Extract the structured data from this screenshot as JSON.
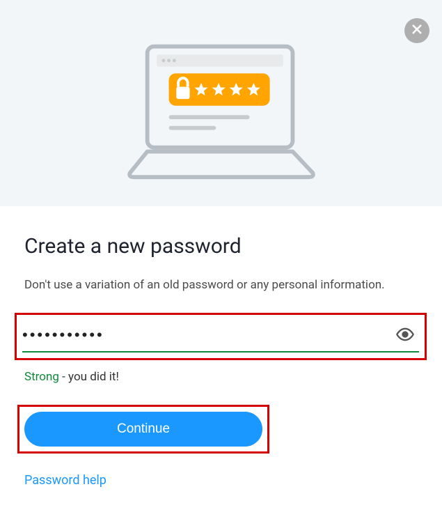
{
  "heading": "Create a new password",
  "subtext": "Don't use a variation of an old password or any personal information.",
  "password_value": "•••••••••••",
  "strength_label": "Strong",
  "strength_rest": " - you did it!",
  "continue_label": "Continue",
  "help_label": "Password help",
  "colors": {
    "accent_orange": "#ffa400",
    "strength_green": "#0f8a3a",
    "primary_blue": "#1a98ff",
    "highlight_red": "#d60000"
  }
}
